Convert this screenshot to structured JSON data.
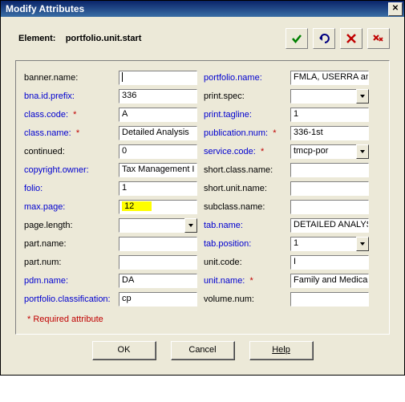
{
  "window": {
    "title": "Modify Attributes"
  },
  "header": {
    "element_label": "Element:",
    "element_value": "portfolio.unit.start"
  },
  "fields": {
    "banner_name": {
      "label": "banner.name:",
      "value": ""
    },
    "bna_id_prefix": {
      "label": "bna.id.prefix:",
      "value": "336"
    },
    "class_code": {
      "label": "class.code:",
      "value": "A"
    },
    "class_name": {
      "label": "class.name:",
      "value": "Detailed Analysis"
    },
    "continued": {
      "label": "continued:",
      "value": "0"
    },
    "copyright_owner": {
      "label": "copyright.owner:",
      "value": "Tax Management I"
    },
    "folio": {
      "label": "folio:",
      "value": "1"
    },
    "max_page": {
      "label": "max.page:",
      "value": "12"
    },
    "page_length": {
      "label": "page.length:",
      "value": ""
    },
    "part_name": {
      "label": "part.name:",
      "value": ""
    },
    "part_num": {
      "label": "part.num:",
      "value": ""
    },
    "pdm_name": {
      "label": "pdm.name:",
      "value": "DA"
    },
    "portfolio_classification": {
      "label": "portfolio.classification:",
      "value": "cp"
    },
    "portfolio_name": {
      "label": "portfolio.name:",
      "value": "FMLA, USERRA and"
    },
    "print_spec": {
      "label": "print.spec:",
      "value": ""
    },
    "print_tagline": {
      "label": "print.tagline:",
      "value": "1"
    },
    "publication_num": {
      "label": "publication.num:",
      "value": "336-1st"
    },
    "service_code": {
      "label": "service.code:",
      "value": "tmcp-por"
    },
    "short_class_name": {
      "label": "short.class.name:",
      "value": ""
    },
    "short_unit_name": {
      "label": "short.unit.name:",
      "value": ""
    },
    "subclass_name": {
      "label": "subclass.name:",
      "value": ""
    },
    "tab_name": {
      "label": "tab.name:",
      "value": "DETAILED ANALYSI"
    },
    "tab_position": {
      "label": "tab.position:",
      "value": "1"
    },
    "unit_code": {
      "label": "unit.code:",
      "value": "I"
    },
    "unit_name": {
      "label": "unit.name:",
      "value": "Family and Medical"
    },
    "volume_num": {
      "label": "volume.num:",
      "value": ""
    }
  },
  "required_note": "* Required attribute",
  "buttons": {
    "ok": "OK",
    "cancel": "Cancel",
    "help": "Help"
  }
}
